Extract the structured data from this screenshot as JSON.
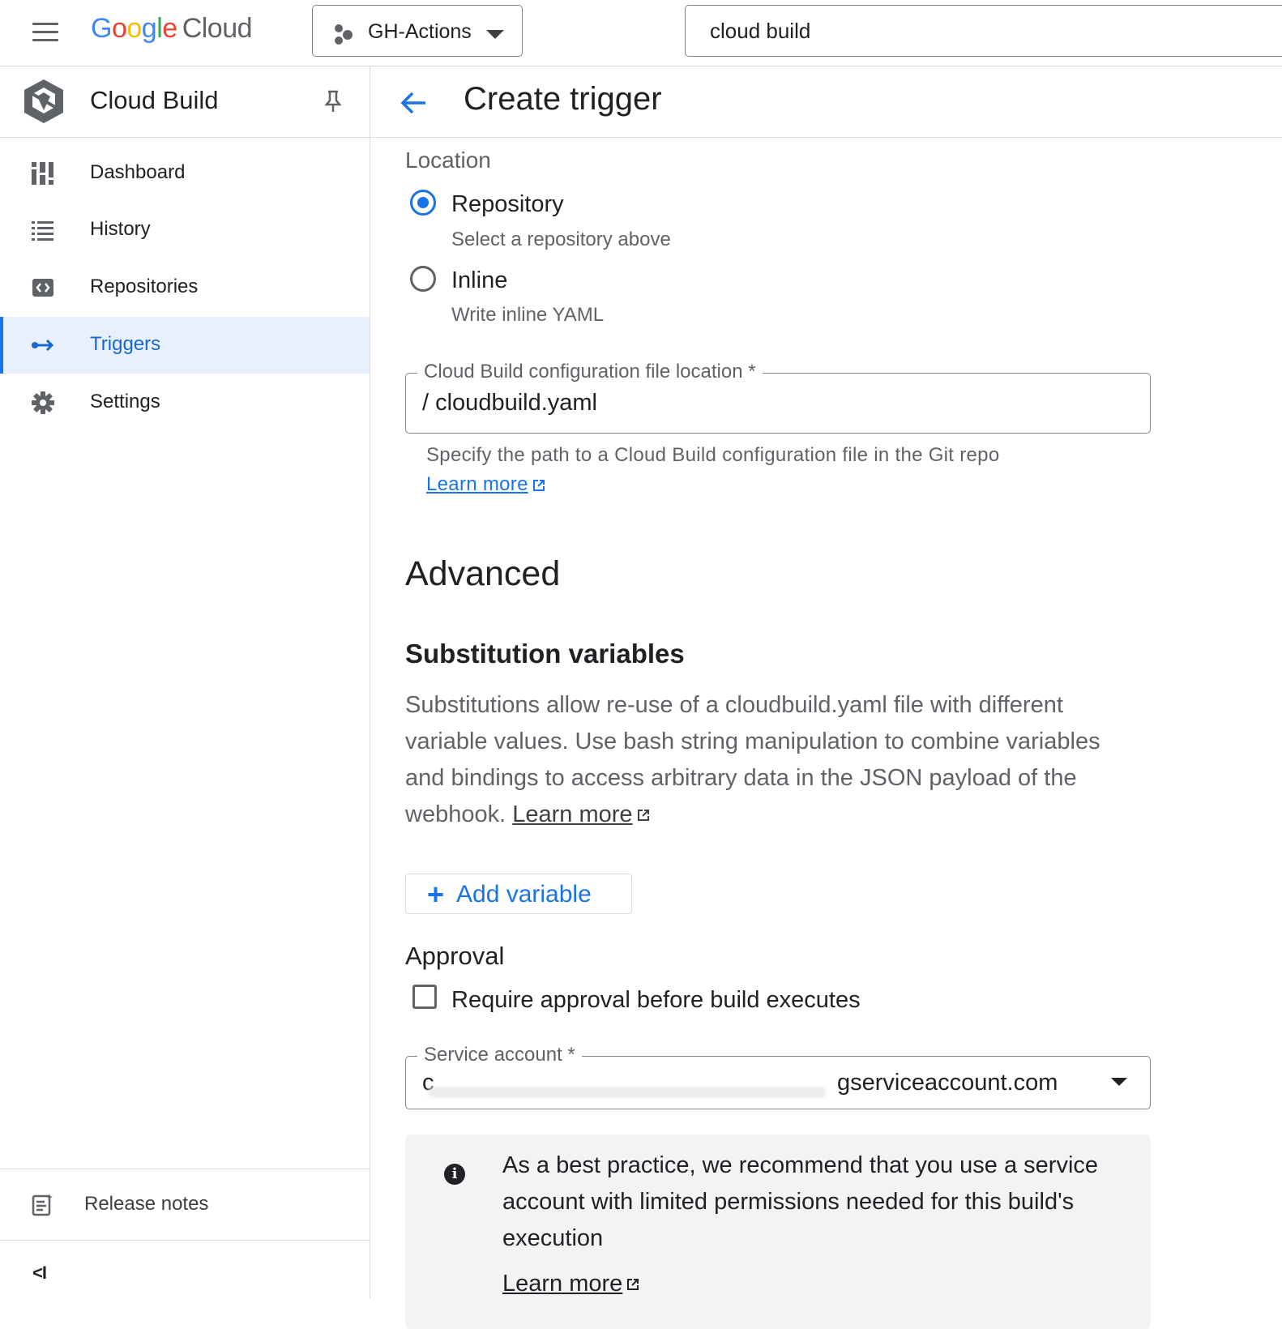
{
  "topbar": {
    "logo_google": "Google",
    "logo_cloud": "Cloud",
    "project": "GH-Actions",
    "search_value": "cloud build"
  },
  "sidebar": {
    "title": "Cloud Build",
    "items": [
      {
        "label": "Dashboard",
        "icon": "dashboard-icon"
      },
      {
        "label": "History",
        "icon": "list-icon"
      },
      {
        "label": "Repositories",
        "icon": "repository-icon"
      },
      {
        "label": "Triggers",
        "icon": "trigger-arrow-icon",
        "active": true
      },
      {
        "label": "Settings",
        "icon": "gear-icon"
      }
    ],
    "release_notes": "Release notes",
    "collapse": "<I"
  },
  "header": {
    "title": "Create trigger"
  },
  "location": {
    "label": "Location",
    "options": [
      {
        "label": "Repository",
        "sub": "Select a repository above",
        "selected": true
      },
      {
        "label": "Inline",
        "sub": "Write inline YAML",
        "selected": false
      }
    ]
  },
  "config_file": {
    "label": "Cloud Build configuration file location *",
    "value": "/ cloudbuild.yaml",
    "helper": "Specify the path to a Cloud Build configuration file in the Git repo",
    "learn_more": "Learn more"
  },
  "advanced": {
    "heading": "Advanced",
    "substitution_heading": "Substitution variables",
    "substitution_text": "Substitutions allow re-use of a cloudbuild.yaml file with different variable values. Use bash string manipulation to combine variables and bindings to access arbitrary data in the JSON payload of the webhook.",
    "substitution_learn_more": "Learn more",
    "add_variable": "Add variable",
    "approval_heading": "Approval",
    "approval_checkbox": "Require approval before build executes",
    "approval_checked": false
  },
  "service_account": {
    "label": "Service account *",
    "value_visible": "gserviceaccount.com",
    "redacted_prefix": "c"
  },
  "info": {
    "text": "As a best practice, we recommend that you use a service account with limited permissions needed for this build's execution",
    "learn_more": "Learn more"
  },
  "colors": {
    "accent": "#1a73e8",
    "active_bg": "#e8f0fe",
    "google_blue": "#4285F4",
    "google_red": "#EA4335",
    "google_yellow": "#FBBC05",
    "google_green": "#34A853"
  }
}
